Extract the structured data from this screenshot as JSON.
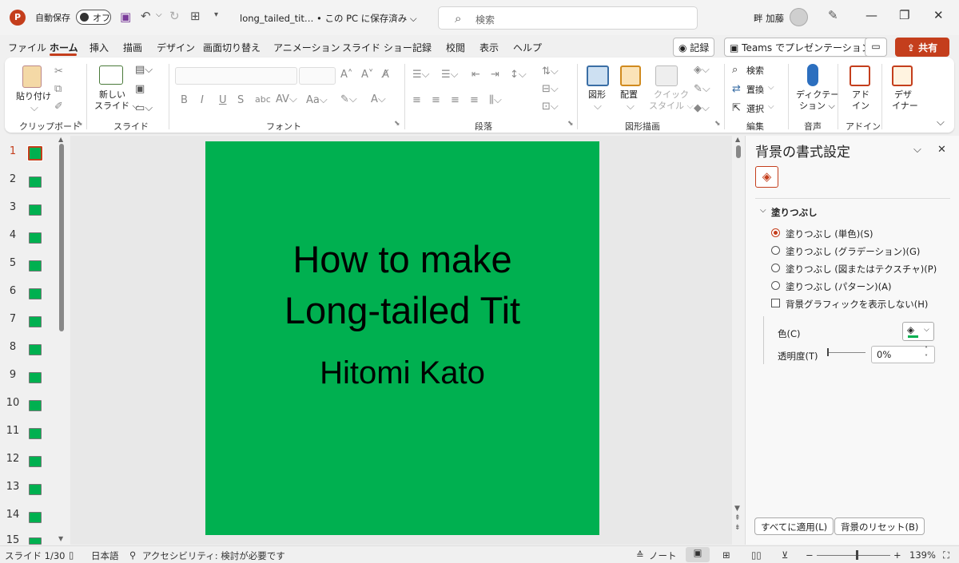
{
  "titlebar": {
    "app_logo": "P",
    "autosave_label": "自動保存",
    "autosave_state": "オフ",
    "doc_title": "long_tailed_tit… • この PC に保存済み ⌵",
    "search_placeholder": "検索",
    "user_name": "畔 加藤"
  },
  "menu": {
    "tabs": [
      "ファイル",
      "ホーム",
      "挿入",
      "描画",
      "デザイン",
      "画面切り替え",
      "アニメーション",
      "スライド ショー",
      "記録",
      "校閲",
      "表示",
      "ヘルプ"
    ],
    "record_btn": "◉ 記録",
    "teams_btn": "Teams でプレゼンテーション",
    "share_btn": "共有"
  },
  "ribbon": {
    "clipboard": {
      "paste": "貼り付け",
      "label": "クリップボード"
    },
    "slides": {
      "new_slide_1": "新しい",
      "new_slide_2": "スライド ⌵",
      "label": "スライド"
    },
    "font": {
      "label": "フォント"
    },
    "paragraph": {
      "label": "段落"
    },
    "drawing": {
      "shape": "図形",
      "arrange": "配置",
      "quick1": "クイック",
      "quick2": "スタイル ⌵",
      "label": "図形描画"
    },
    "editing": {
      "find": "検索",
      "replace": "置換",
      "select": "選択",
      "label": "編集"
    },
    "voice": {
      "dictate1": "ディクテー",
      "dictate2": "ション ⌵",
      "label": "音声"
    },
    "addins": {
      "text1": "アド",
      "text2": "イン",
      "label": "アドイン"
    },
    "designer": {
      "text1": "デザ",
      "text2": "イナー"
    }
  },
  "thumbnails": [
    "1",
    "2",
    "3",
    "4",
    "5",
    "6",
    "7",
    "8",
    "9",
    "10",
    "11",
    "12",
    "13",
    "14",
    "15"
  ],
  "slide": {
    "title_line1": "How to make",
    "title_line2": "Long-tailed Tit",
    "subtitle": "Hitomi Kato",
    "background": "#00B050"
  },
  "pane": {
    "title": "背景の書式設定",
    "section": "塗りつぶし",
    "options": [
      "塗りつぶし (単色)(S)",
      "塗りつぶし (グラデーション)(G)",
      "塗りつぶし (図またはテクスチャ)(P)",
      "塗りつぶし (パターン)(A)"
    ],
    "hide_graphics": "背景グラフィックを表示しない(H)",
    "color_label": "色(C)",
    "transparency_label": "透明度(T)",
    "transparency_value": "0%",
    "apply_all": "すべてに適用(L)",
    "reset": "背景のリセット(B)"
  },
  "status": {
    "slide_info": "スライド 1/30",
    "language": "日本語",
    "accessibility": "アクセシビリティ: 検討が必要です",
    "notes": "ノート",
    "zoom": "139%"
  },
  "colors": {
    "accent": "#C43E1C",
    "slide_bg": "#00B050"
  }
}
